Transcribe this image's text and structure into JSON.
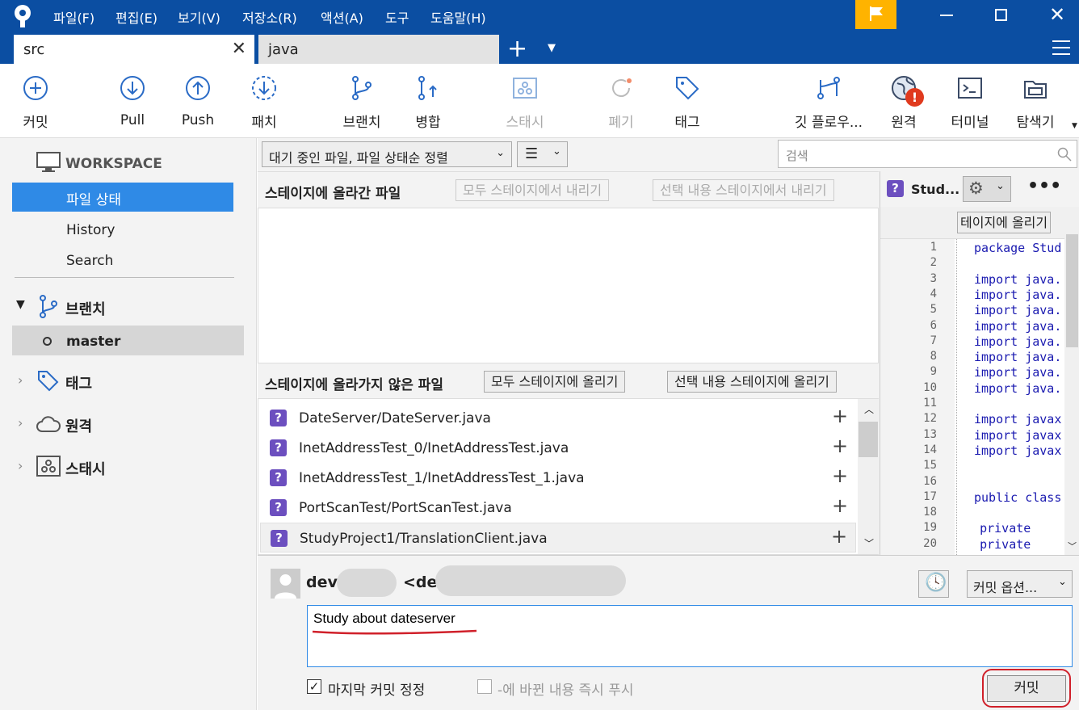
{
  "menu": [
    "파일(F)",
    "편집(E)",
    "보기(V)",
    "저장소(R)",
    "액션(A)",
    "도구",
    "도움말(H)"
  ],
  "tabs": {
    "active": "src",
    "inactive": "java"
  },
  "toolbar": {
    "commit": "커밋",
    "pull": "Pull",
    "push": "Push",
    "patch": "패치",
    "branch": "브랜치",
    "merge": "병합",
    "stash": "스태시",
    "discard": "폐기",
    "tag": "태그",
    "gitflow": "깃 플로우...",
    "remote": "원격",
    "terminal": "터미널",
    "explorer": "탐색기"
  },
  "sidebar": {
    "workspace": "WORKSPACE",
    "file_status": "파일 상태",
    "history": "History",
    "search": "Search",
    "branches": "브랜치",
    "master": "master",
    "tags": "태그",
    "remotes": "원격",
    "stashes": "스태시"
  },
  "filter": {
    "sort": "대기 중인 파일, 파일 상태순 정렬",
    "search_placeholder": "검색"
  },
  "staged": {
    "title": "스테이지에 올라간 파일",
    "unstage_all": "모두 스테이지에서 내리기",
    "unstage_sel": "선택 내용 스테이지에서 내리기"
  },
  "unstaged": {
    "title": "스테이지에 올라가지 않은 파일",
    "stage_all": "모두 스테이지에 올리기",
    "stage_sel": "선택 내용 스테이지에 올리기",
    "files": [
      "DateServer/DateServer.java",
      "InetAddressTest_0/InetAddressTest.java",
      "InetAddressTest_1/InetAddressTest_1.java",
      "PortScanTest/PortScanTest.java",
      "StudyProject1/TranslationClient.java"
    ]
  },
  "diff": {
    "file": "Stud...",
    "stage_btn": "테이지에 올리기",
    "lines": [
      {
        "n": "1",
        "t": "package Stud"
      },
      {
        "n": "2",
        "t": ""
      },
      {
        "n": "3",
        "t": "import java."
      },
      {
        "n": "4",
        "t": "import java."
      },
      {
        "n": "5",
        "t": "import java."
      },
      {
        "n": "6",
        "t": "import java."
      },
      {
        "n": "7",
        "t": "import java."
      },
      {
        "n": "8",
        "t": "import java."
      },
      {
        "n": "9",
        "t": "import java."
      },
      {
        "n": "10",
        "t": "import java."
      },
      {
        "n": "11",
        "t": ""
      },
      {
        "n": "12",
        "t": "import javax"
      },
      {
        "n": "13",
        "t": "import javax"
      },
      {
        "n": "14",
        "t": "import javax"
      },
      {
        "n": "15",
        "t": ""
      },
      {
        "n": "16",
        "t": ""
      },
      {
        "n": "17",
        "t": "public class"
      },
      {
        "n": "18",
        "t": ""
      },
      {
        "n": "19",
        "t": "   private"
      },
      {
        "n": "20",
        "t": "   private"
      }
    ]
  },
  "commit": {
    "author_name": "dev",
    "author_email": "<dev",
    "options": "커밋 옵션...",
    "message": "Study about dateserver",
    "amend": "마지막 커밋 정정",
    "push_now": "-에 바뀐 내용 즉시 푸시",
    "commit_btn": "커밋"
  },
  "colors": {
    "titlebar": "#0b4ea2",
    "selection": "#2f8ae6",
    "unknown_icon": "#6c4fbf",
    "flag": "#ffb300"
  }
}
